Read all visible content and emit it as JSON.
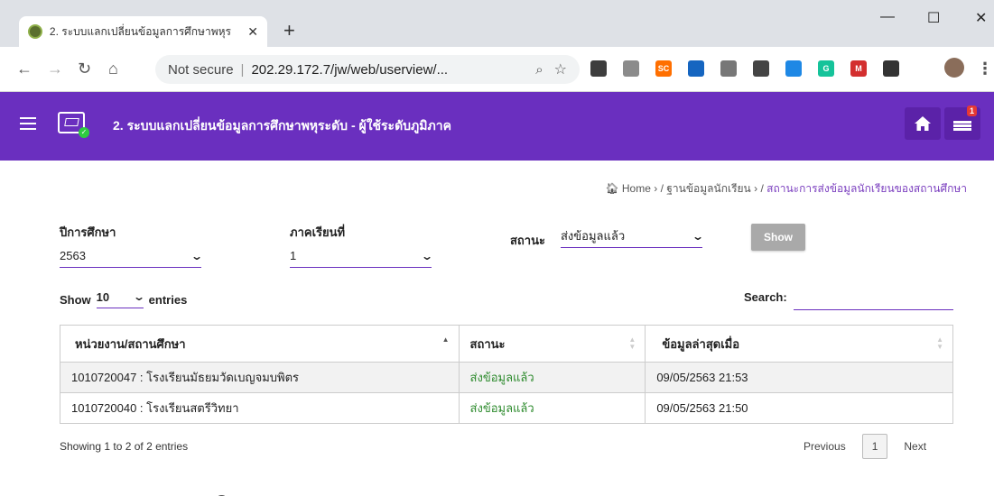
{
  "browser": {
    "tab_title": "2. ระบบแลกเปลี่ยนข้อมูลการศึกษาพหุร",
    "tab_close": "✕",
    "new_tab": "+",
    "win_min": "—",
    "win_max": "☐",
    "win_close": "✕",
    "not_secure": "Not secure",
    "url": "202.29.172.7/jw/web/userview/...",
    "extensions": [
      {
        "name": "speech-bubble-extension",
        "color": "#3d3d3d",
        "label": ""
      },
      {
        "name": "document-extension",
        "color": "#8b8b8b",
        "label": ""
      },
      {
        "name": "sc-extension",
        "color": "#ff6f00",
        "label": "SC"
      },
      {
        "name": "circle-extension",
        "color": "#1565c0",
        "label": ""
      },
      {
        "name": "pdf-extension",
        "color": "#777",
        "label": ""
      },
      {
        "name": "gauge-extension",
        "color": "#444",
        "label": ""
      },
      {
        "name": "grad-cap-extension",
        "color": "#1e88e5",
        "label": ""
      },
      {
        "name": "grammarly-extension",
        "color": "#15c39a",
        "label": "G"
      },
      {
        "name": "red-m-extension",
        "color": "#d32f2f",
        "label": "M"
      },
      {
        "name": "grid-extension",
        "color": "#333",
        "label": ""
      }
    ]
  },
  "header": {
    "title": "2. ระบบแลกเปลี่ยนข้อมูลการศึกษาพหุระดับ - ผู้ใช้ระดับภูมิภาค",
    "notification_count": "1"
  },
  "breadcrumb": {
    "home": "Home",
    "sep1": "›  /",
    "level2": "ฐานข้อมูลนักเรียน",
    "sep2": "›  /",
    "current": "สถานะการส่งข้อมูลนักเรียนของสถานศึกษา"
  },
  "filters": {
    "year_label": "ปีการศึกษา",
    "year_value": "2563",
    "term_label": "ภาคเรียนที่",
    "term_value": "1",
    "status_label": "สถานะ",
    "status_value": "ส่งข้อมูลแล้ว",
    "show_button": "Show"
  },
  "table_controls": {
    "show_label": "Show",
    "length_value": "10",
    "entries_label": "entries",
    "search_label": "Search:"
  },
  "table": {
    "columns": [
      "หน่วยงาน/สถานศึกษา",
      "สถานะ",
      "ข้อมูลล่าสุดเมื่อ"
    ],
    "rows": [
      [
        "1010720047 : โรงเรียนมัธยมวัดเบญจมบพิตร",
        "ส่งข้อมูลแล้ว",
        "09/05/2563 21:53"
      ],
      [
        "1010720040 : โรงเรียนสตรีวิทยา",
        "ส่งข้อมูลแล้ว",
        "09/05/2563 21:50"
      ]
    ],
    "status_color": "#2e8b2e"
  },
  "footer": {
    "info": "Showing 1 to 2 of 2 entries",
    "previous": "Previous",
    "page": "1",
    "next": "Next"
  },
  "colors": {
    "brand": "#6a2fbf",
    "header_button": "#5b22a8",
    "show_button": "#a9a9a9"
  }
}
